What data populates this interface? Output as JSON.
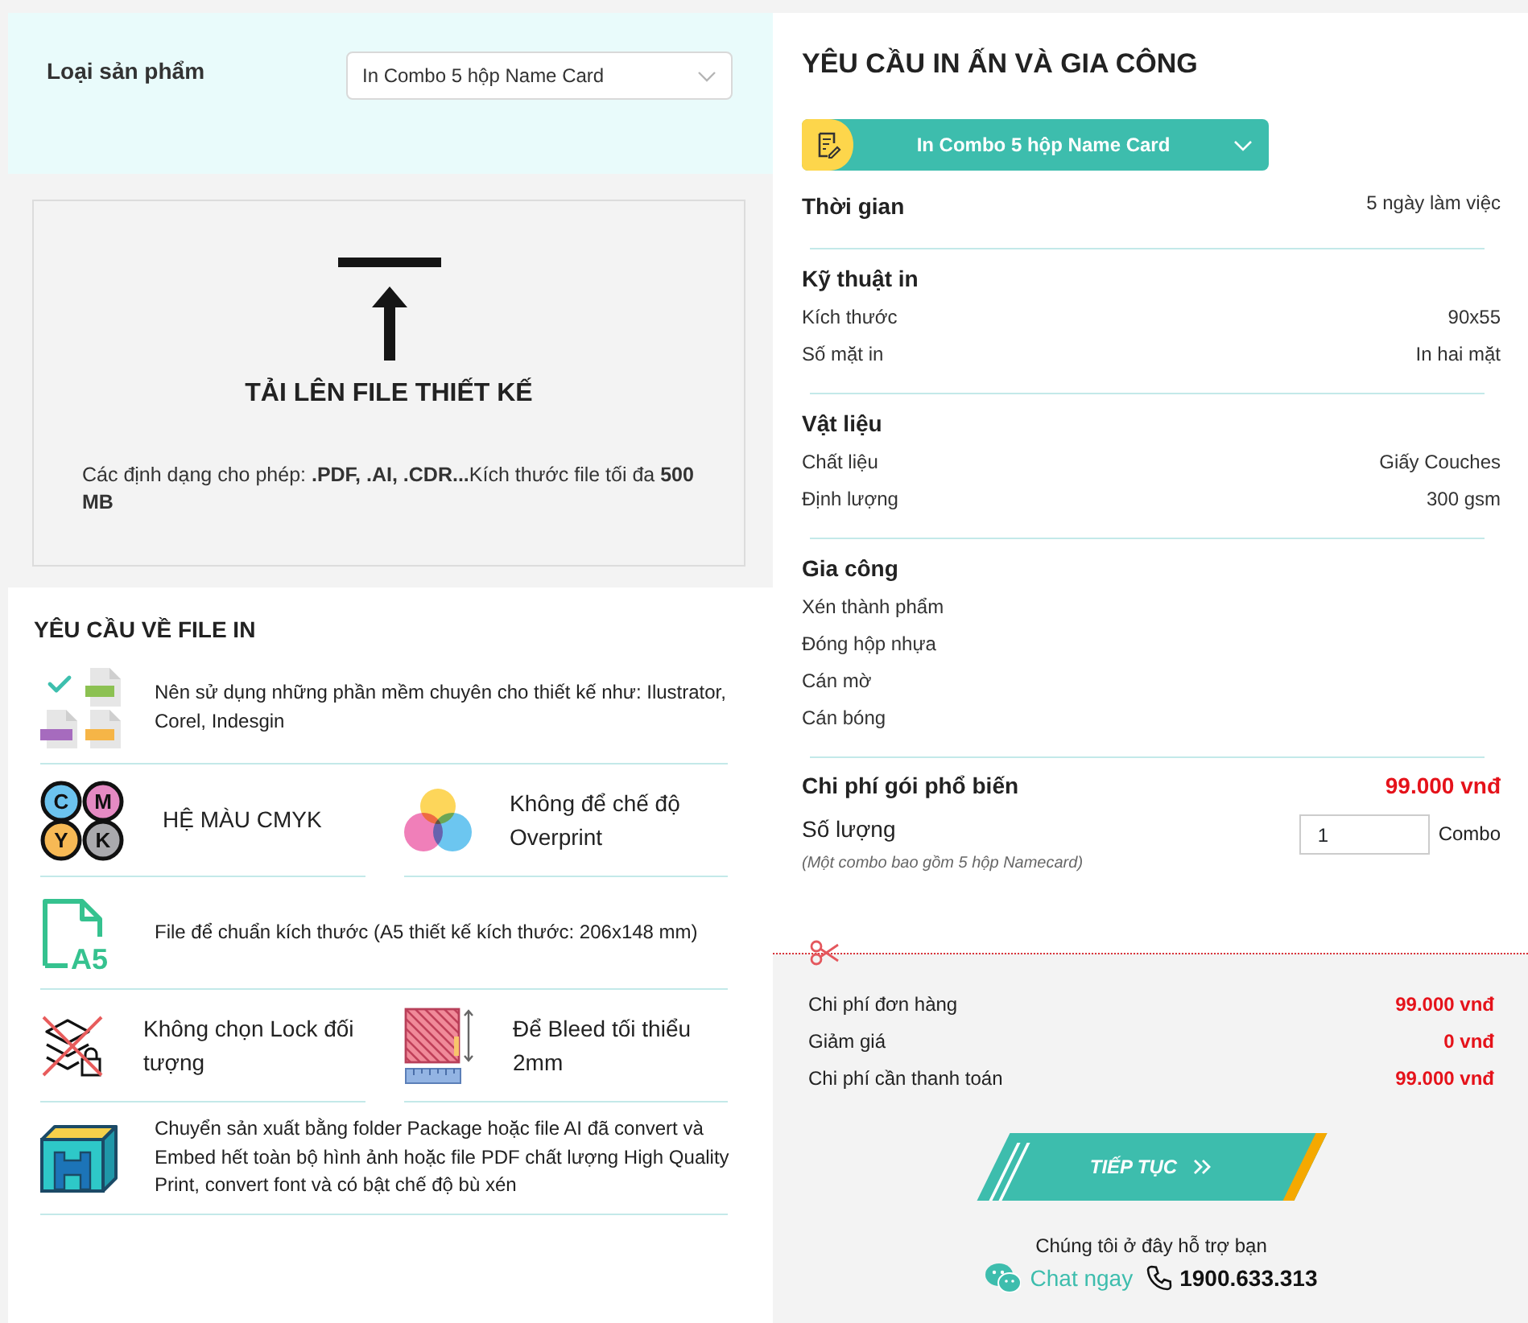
{
  "product_type": {
    "label": "Loại sản phẩm",
    "value": "In Combo 5 hộp Name Card"
  },
  "upload": {
    "title": "TẢI LÊN FILE THIẾT KẾ",
    "note": "Các định dạng cho phép: **.PDF, .AI, .CDR...**Kích thước file tối đa **500 MB**"
  },
  "file_requirements": {
    "title": "YÊU CẦU VỀ FILE IN",
    "rows": [
      {
        "items": [
          {
            "kind": "software",
            "text": "Nên sử dụng những phần mềm chuyên cho thiết kế như: Ilustrator, Corel, Indesgin"
          }
        ]
      },
      {
        "items": [
          {
            "kind": "cmyk",
            "icon_labels": [
              "C",
              "M",
              "Y",
              "K"
            ],
            "text": "HỆ MÀU CMYK"
          },
          {
            "kind": "overprint",
            "text": "Không để chế độ Overprint"
          }
        ]
      },
      {
        "items": [
          {
            "kind": "a5",
            "icon_labels": [
              "A5"
            ],
            "text": "File để chuẩn kích thước (A5 thiết kế kích thước: 206x148 mm)"
          }
        ]
      },
      {
        "items": [
          {
            "kind": "lock",
            "text": "Không chọn Lock đối tượng"
          },
          {
            "kind": "bleed",
            "text": "Để Bleed tối thiểu 2mm"
          }
        ]
      },
      {
        "items": [
          {
            "kind": "package",
            "text": "Chuyển sản xuất bằng folder Package hoặc file AI đã convert và Embed hết toàn bộ hình ảnh hoặc file PDF chất lượng High Quality Print, convert font và có bật chế độ bù xén"
          }
        ]
      }
    ]
  },
  "print_request": {
    "title": "YÊU CẦU IN ẤN VÀ GIA CÔNG",
    "product_button": "In Combo 5 hộp Name Card",
    "sections": [
      {
        "title": "Thời gian",
        "value": "5 ngày làm việc"
      },
      {
        "title": "Kỹ thuật in",
        "rows": [
          {
            "label": "Kích thước",
            "value": "90x55"
          },
          {
            "label": "Số mặt in",
            "value": "In hai mặt"
          }
        ]
      },
      {
        "title": "Vật liệu",
        "rows": [
          {
            "label": "Chất liệu",
            "value": "Giấy Couches"
          },
          {
            "label": "Định lượng",
            "value": "300 gsm"
          }
        ]
      },
      {
        "title": "Gia công",
        "rows": [
          {
            "label": "Xén thành phẩm"
          },
          {
            "label": "Đóng hộp nhựa"
          },
          {
            "label": "Cán mờ"
          },
          {
            "label": "Cán bóng"
          }
        ]
      }
    ],
    "package_cost": {
      "label": "Chi phí gói phổ biến",
      "value": "99.000 vnđ"
    },
    "quantity": {
      "label": "Số lượng",
      "value": "1",
      "unit": "Combo",
      "note": "(Một combo bao gồm 5 hộp Namecard)"
    }
  },
  "summary": {
    "rows": [
      {
        "label": "Chi phí đơn hàng",
        "value": "99.000 vnđ"
      },
      {
        "label": "Giảm giá",
        "value": "0 vnđ"
      },
      {
        "label": "Chi phí cần thanh toán",
        "value": "99.000 vnđ"
      }
    ],
    "continue_button": "TIẾP TỤC",
    "support_text": "Chúng tôi ở đây hỗ trợ bạn",
    "chat_link": "Chat ngay",
    "hotline": "1900.633.313"
  }
}
